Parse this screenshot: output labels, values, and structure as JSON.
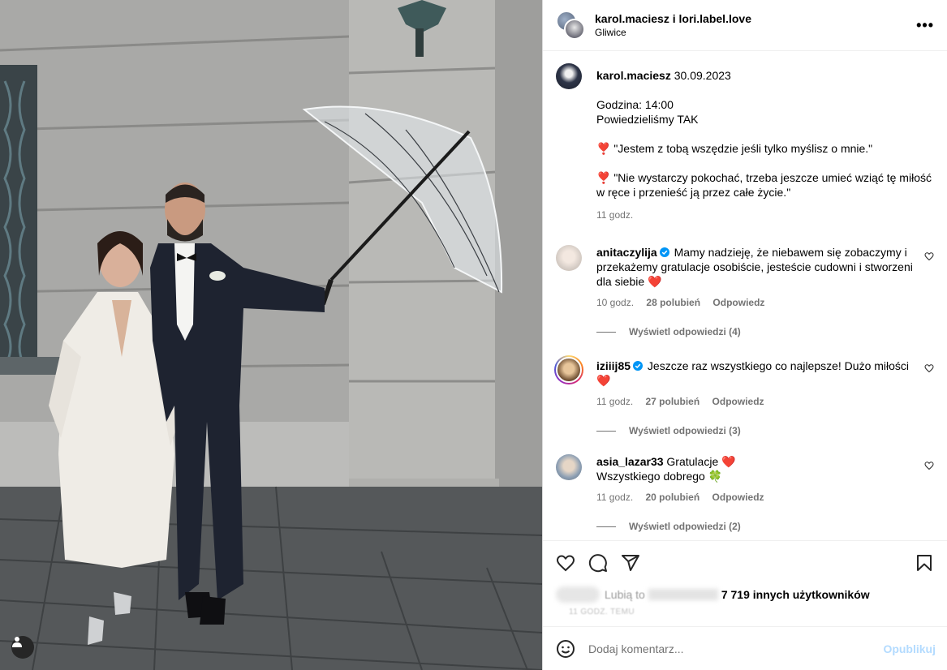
{
  "header": {
    "names": "karol.maciesz i lori.label.love",
    "location": "Gliwice",
    "more_icon": "more-horizontal-icon"
  },
  "caption": {
    "username": "karol.maciesz",
    "date": "30.09.2023",
    "line1": "Godzina: 14:00",
    "line2": "Powiedzieliśmy TAK",
    "quote1_emoji": "❣️",
    "quote1": "\"Jestem z tobą wszędzie jeśli tylko myślisz o mnie.\"",
    "quote2_emoji": "❣️",
    "quote2": "\"Nie wystarczy pokochać, trzeba jeszcze umieć wziąć tę miłość w ręce i przenieść ją przez całe życie.\"",
    "time": "11 godz."
  },
  "comments": [
    {
      "username": "anitaczylija",
      "verified": true,
      "text": "Mamy nadzieję, że niebawem się zobaczymy i przekażemy gratulacje osobiście, jesteście cudowni i stworzeni dla siebie",
      "emoji": "❤️",
      "time": "10 godz.",
      "likes": "28 polubień",
      "reply": "Odpowiedz",
      "view_replies": "Wyświetl odpowiedzi (4)"
    },
    {
      "username": "iziiij85",
      "verified": true,
      "text": "Jeszcze raz wszystkiego co najlepsze! Dużo miłości",
      "emoji": "❤️",
      "time": "11 godz.",
      "likes": "27 polubień",
      "reply": "Odpowiedz",
      "view_replies": "Wyświetl odpowiedzi (3)"
    },
    {
      "username": "asia_lazar33",
      "verified": false,
      "text": "Gratulacje",
      "emoji": "❤️",
      "text2": "Wszystkiego dobrego",
      "emoji2": "🍀",
      "time": "11 godz.",
      "likes": "20 polubień",
      "reply": "Odpowiedz",
      "view_replies": "Wyświetl odpowiedzi (2)"
    }
  ],
  "actions": {
    "icons": [
      "heart-icon",
      "comment-icon",
      "share-icon",
      "bookmark-icon"
    ],
    "likes_prefix": "Lubią to",
    "likes_count": "7 719 innych użytkowników",
    "time_ago": "11 GODZ. TEMU"
  },
  "add_comment": {
    "placeholder": "Dodaj komentarz...",
    "post_label": "Opublikuj"
  },
  "colors": {
    "link_blue": "#b3dbff",
    "muted": "#737373",
    "heart_red": "#ed4956",
    "verified_blue": "#0095f6"
  }
}
